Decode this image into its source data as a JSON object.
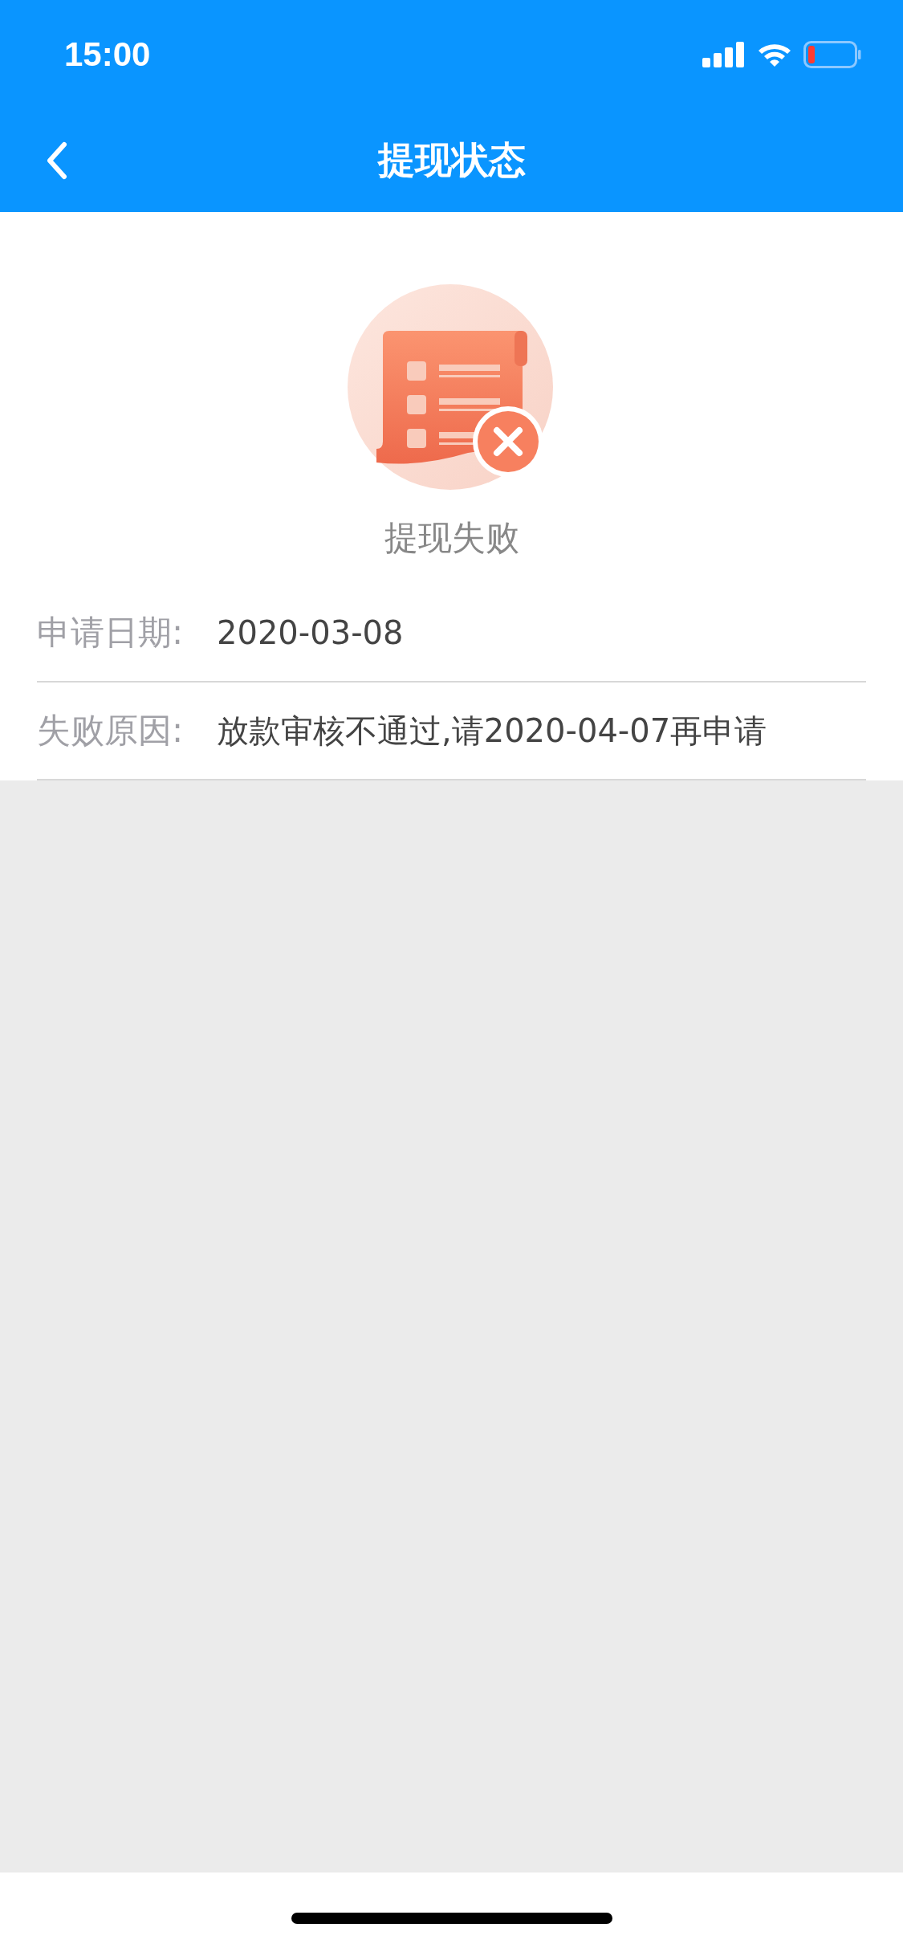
{
  "status_bar": {
    "time": "15:00"
  },
  "nav_bar": {
    "title": "提现状态"
  },
  "result": {
    "kind": "failed",
    "text": "提现失败"
  },
  "details": [
    {
      "label": "申请日期:",
      "value": "2020-03-08"
    },
    {
      "label": "失败原因:",
      "value": "放款审核不通过,请2020-04-07再申请"
    }
  ]
}
